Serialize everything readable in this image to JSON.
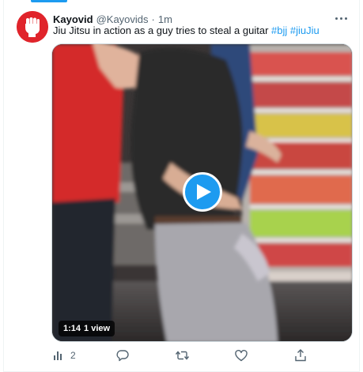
{
  "tweet": {
    "display_name": "Kayovid",
    "handle": "@Kayovids",
    "separator": "·",
    "time": "1m",
    "text": {
      "plain": "Jiu Jitsu in action as a guy tries to steal a guitar ",
      "hashtags": [
        "#bjj",
        "#jiuJiu"
      ]
    },
    "video": {
      "duration": "1:14",
      "views": "1 view"
    },
    "actions": {
      "views_count": "2"
    }
  },
  "colors": {
    "accent": "#1d9bf0",
    "avatar_bg": "#e0242b",
    "secondary_text": "#536471"
  },
  "icons": {
    "avatar": "raised-fist-logo",
    "more": "more-horizontal-icon",
    "play": "play-icon",
    "views": "analytics-icon",
    "reply": "reply-icon",
    "retweet": "retweet-icon",
    "like": "heart-icon",
    "share": "share-icon"
  }
}
